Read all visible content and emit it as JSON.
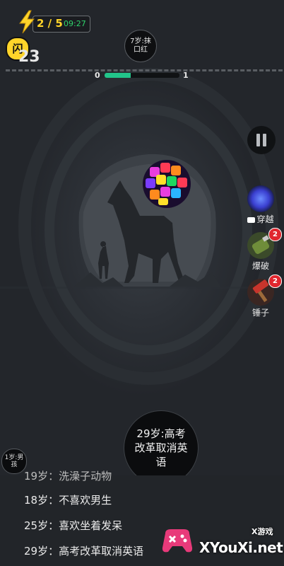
{
  "hud": {
    "energy_count": "2 / 5",
    "timer": "09:27",
    "flash_char": "闪",
    "flash_number": "23",
    "target_text": "7岁:抹口红",
    "progress_start": "0",
    "progress_end": "1",
    "progress_fraction": 0.35
  },
  "tools": {
    "travel_label": "穿越",
    "blast_label": "爆破",
    "blast_count": "2",
    "hammer_label": "锤子",
    "hammer_count": "2"
  },
  "bubbles": {
    "big_text": "29岁:高考改革取消英语",
    "small_text": "1岁:男孩"
  },
  "history": {
    "cut_off_item": "19岁：洗澡子动物",
    "items": [
      "18岁：不喜欢男生",
      "25岁：喜欢坐着发呆",
      "29岁：高考改革取消英语"
    ]
  },
  "watermark": {
    "site": "XYouXi.net",
    "tag": "X游戏"
  },
  "colors": {
    "accent_yellow": "#ffd42a",
    "progress_green": "#22c48a",
    "timer_green": "#2fd36b",
    "badge_red": "#e0262e"
  }
}
